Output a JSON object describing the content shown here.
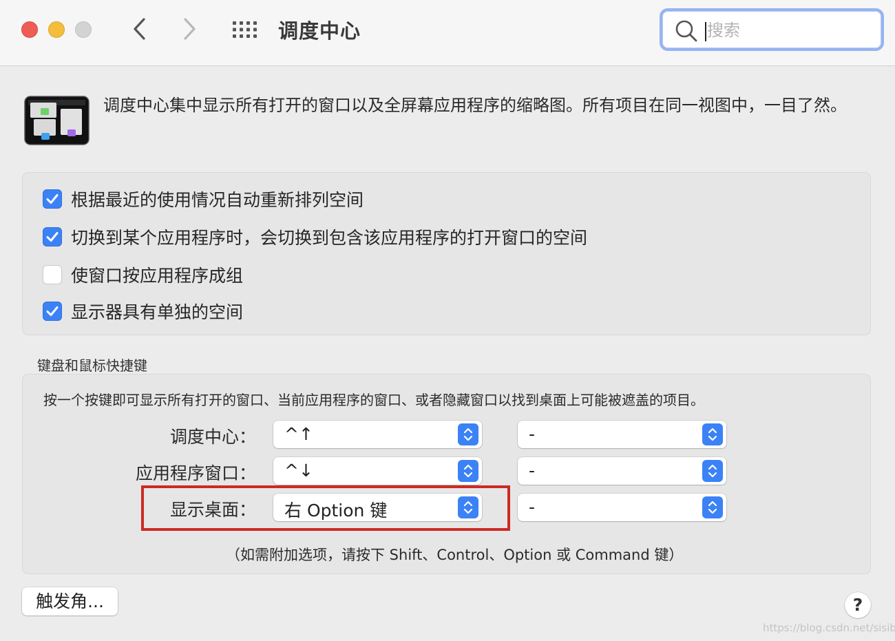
{
  "window": {
    "title": "调度中心",
    "search_placeholder": "搜索"
  },
  "header": {
    "description": "调度中心集中显示所有打开的窗口以及全屏幕应用程序的缩略图。所有项目在同一视图中，一目了然。"
  },
  "options": [
    {
      "label": "根据最近的使用情况自动重新排列空间",
      "checked": true
    },
    {
      "label": "切换到某个应用程序时，会切换到包含该应用程序的打开窗口的空间",
      "checked": true
    },
    {
      "label": "使窗口按应用程序成组",
      "checked": false
    },
    {
      "label": "显示器具有单独的空间",
      "checked": true
    }
  ],
  "shortcuts": {
    "section_title": "键盘和鼠标快捷键",
    "description": "按一个按键即可显示所有打开的窗口、当前应用程序的窗口、或者隐藏窗口以找到桌面上可能被遮盖的项目。",
    "rows": [
      {
        "label": "调度中心：",
        "keyboard": "^↑",
        "mouse": "-"
      },
      {
        "label": "应用程序窗口：",
        "keyboard": "^↓",
        "mouse": "-"
      },
      {
        "label": "显示桌面：",
        "keyboard": "右 Option 键",
        "mouse": "-"
      }
    ],
    "note": "（如需附加选项，请按下 Shift、Control、Option 或 Command 键）"
  },
  "buttons": {
    "hot_corners": "触发角...",
    "help": "?"
  },
  "watermark": "https://blog.csdn.net/sisibf",
  "colors": {
    "accent": "#3b82f6",
    "highlight_box": "#cc2a22",
    "traffic_red": "#ee5c55",
    "traffic_yellow": "#f5bd3c",
    "traffic_gray": "#d3d3d3"
  }
}
